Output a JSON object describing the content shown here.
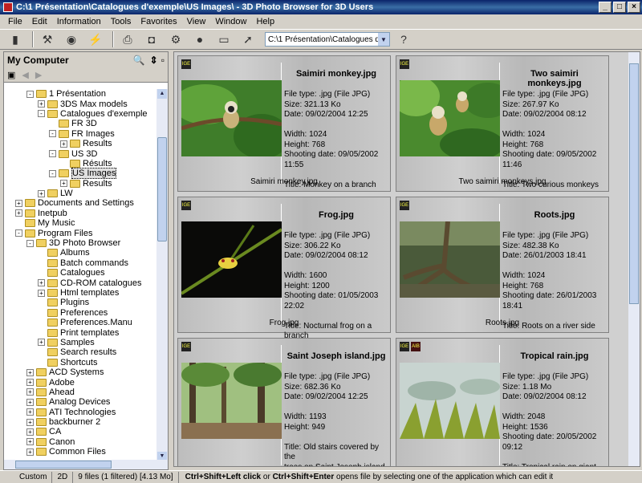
{
  "window": {
    "title": "C:\\1 Présentation\\Catalogues d'exemple\\US Images\\ - 3D Photo Browser for 3D Users"
  },
  "menu": [
    "File",
    "Edit",
    "Information",
    "Tools",
    "Favorites",
    "View",
    "Window",
    "Help"
  ],
  "toolbar": {
    "path": "C:\\1 Présentation\\Catalogues d'exem"
  },
  "left": {
    "title": "My Computer"
  },
  "tree": [
    {
      "label": "1 Présentation",
      "depth": 3,
      "exp": "-"
    },
    {
      "label": "3DS Max models",
      "depth": 4,
      "exp": "+"
    },
    {
      "label": "Catalogues d'exemple",
      "depth": 4,
      "exp": "-"
    },
    {
      "label": "FR 3D",
      "depth": 5,
      "exp": ""
    },
    {
      "label": "FR Images",
      "depth": 5,
      "exp": "-"
    },
    {
      "label": "Results",
      "depth": 6,
      "exp": "+"
    },
    {
      "label": "US 3D",
      "depth": 5,
      "exp": "-"
    },
    {
      "label": "Résults",
      "depth": 6,
      "exp": ""
    },
    {
      "label": "US Images",
      "depth": 5,
      "exp": "-",
      "selected": true
    },
    {
      "label": "Results",
      "depth": 6,
      "exp": "+"
    },
    {
      "label": "LW",
      "depth": 4,
      "exp": "+"
    },
    {
      "label": "Documents and Settings",
      "depth": 2,
      "exp": "+"
    },
    {
      "label": "Inetpub",
      "depth": 2,
      "exp": "+"
    },
    {
      "label": "My Music",
      "depth": 2,
      "exp": ""
    },
    {
      "label": "Program Files",
      "depth": 2,
      "exp": "-"
    },
    {
      "label": "3D Photo Browser",
      "depth": 3,
      "exp": "-"
    },
    {
      "label": "Albums",
      "depth": 4,
      "exp": ""
    },
    {
      "label": "Batch commands",
      "depth": 4,
      "exp": ""
    },
    {
      "label": "Catalogues",
      "depth": 4,
      "exp": ""
    },
    {
      "label": "CD-ROM catalogues",
      "depth": 4,
      "exp": "+"
    },
    {
      "label": "Html templates",
      "depth": 4,
      "exp": "+"
    },
    {
      "label": "Plugins",
      "depth": 4,
      "exp": ""
    },
    {
      "label": "Preferences",
      "depth": 4,
      "exp": ""
    },
    {
      "label": "Preferences.Manu",
      "depth": 4,
      "exp": ""
    },
    {
      "label": "Print templates",
      "depth": 4,
      "exp": ""
    },
    {
      "label": "Samples",
      "depth": 4,
      "exp": "+"
    },
    {
      "label": "Search results",
      "depth": 4,
      "exp": ""
    },
    {
      "label": "Shortcuts",
      "depth": 4,
      "exp": ""
    },
    {
      "label": "ACD Systems",
      "depth": 3,
      "exp": "+"
    },
    {
      "label": "Adobe",
      "depth": 3,
      "exp": "+"
    },
    {
      "label": "Ahead",
      "depth": 3,
      "exp": "+"
    },
    {
      "label": "Analog Devices",
      "depth": 3,
      "exp": "+"
    },
    {
      "label": "ATI Technologies",
      "depth": 3,
      "exp": "+"
    },
    {
      "label": "backburner 2",
      "depth": 3,
      "exp": "+"
    },
    {
      "label": "CA",
      "depth": 3,
      "exp": "+"
    },
    {
      "label": "Canon",
      "depth": 3,
      "exp": "+"
    },
    {
      "label": "Common Files",
      "depth": 3,
      "exp": "+"
    }
  ],
  "photos": [
    {
      "name": "Saimiri monkey.jpg",
      "type": "File type: .jpg (File JPG)",
      "size": "Size: 321.13 Ko",
      "date": "Date: 09/02/2004 12:25",
      "width": "Width: 1024",
      "height": "Height: 768",
      "shot": "Shooting date: 09/05/2002 11:55",
      "title": "Title: Monkey on a branch",
      "title2": "",
      "scene": "monkey"
    },
    {
      "name": "Two saimiri monkeys.jpg",
      "type": "File type: .jpg (File JPG)",
      "size": "Size: 267.97 Ko",
      "date": "Date: 09/02/2004 08:12",
      "width": "Width: 1024",
      "height": "Height: 768",
      "shot": "Shooting date: 09/05/2002 11:46",
      "title": "Title: Two curious monkeys",
      "title2": "",
      "scene": "monkey2"
    },
    {
      "name": "Frog.jpg",
      "type": "File type: .jpg (File JPG)",
      "size": "Size: 306.22 Ko",
      "date": "Date: 09/02/2004 08:12",
      "width": "Width: 1600",
      "height": "Height: 1200",
      "shot": "Shooting date: 01/05/2003 22:02",
      "title": "Title: Nocturnal frog on a branch",
      "title2": "",
      "scene": "frog"
    },
    {
      "name": "Roots.jpg",
      "type": "File type: .jpg (File JPG)",
      "size": "Size: 482.38 Ko",
      "date": "Date: 26/01/2003 18:41",
      "width": "Width: 1024",
      "height": "Height: 768",
      "shot": "Shooting date: 26/01/2003 18:41",
      "title": "Title: Roots on a river side",
      "title2": "",
      "scene": "roots"
    },
    {
      "name": "Saint Joseph island.jpg",
      "type": "File type: .jpg (File JPG)",
      "size": "Size: 682.36 Ko",
      "date": "Date: 09/02/2004 12:25",
      "width": "Width: 1193",
      "height": "Height: 949",
      "shot": "",
      "title": "Title: Old stairs covered by the",
      "title2": "trees on Saint Joseph island",
      "scene": "island"
    },
    {
      "name": "Tropical rain.jpg",
      "type": "File type: .jpg (File JPG)",
      "size": "Size: 1.18 Mo",
      "date": "Date: 09/02/2004 08:12",
      "width": "Width: 2048",
      "height": "Height: 1536",
      "shot": "Shooting date: 20/05/2002 09:12",
      "title": "Title: Tropical rain on giant grass",
      "title2": "",
      "scene": "rain"
    }
  ],
  "status": {
    "custom": "Custom",
    "mode": "2D",
    "files": "9 files (1 filtered) [4.13 Mo]",
    "shortcut1": "Ctrl+Shift+Left  click",
    "mid": " or ",
    "shortcut2": "Ctrl+Shift+Enter",
    "msg": " opens file by selecting one of the application which can edit it"
  }
}
